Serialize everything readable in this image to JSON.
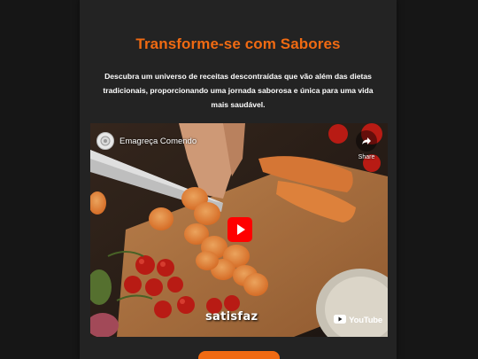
{
  "page": {
    "title": "Transforme-se com Sabores",
    "description": "Descubra um universo de receitas descontraídas que vão além das dietas tradicionais, proporcionando uma jornada saborosa e única para uma vida mais saudável."
  },
  "video": {
    "channel_name": "Emagreça Comendo",
    "share_label": "Share",
    "watermark": "satisfaz",
    "platform_label": "YouTube",
    "icons": {
      "avatar": "avatar-icon",
      "share": "share-arrow-icon",
      "play": "play-button-icon",
      "platform": "youtube-logo-icon"
    }
  },
  "colors": {
    "accent": "#f06a12",
    "background": "#161616",
    "card": "#232323",
    "play_red": "#ff0000"
  }
}
